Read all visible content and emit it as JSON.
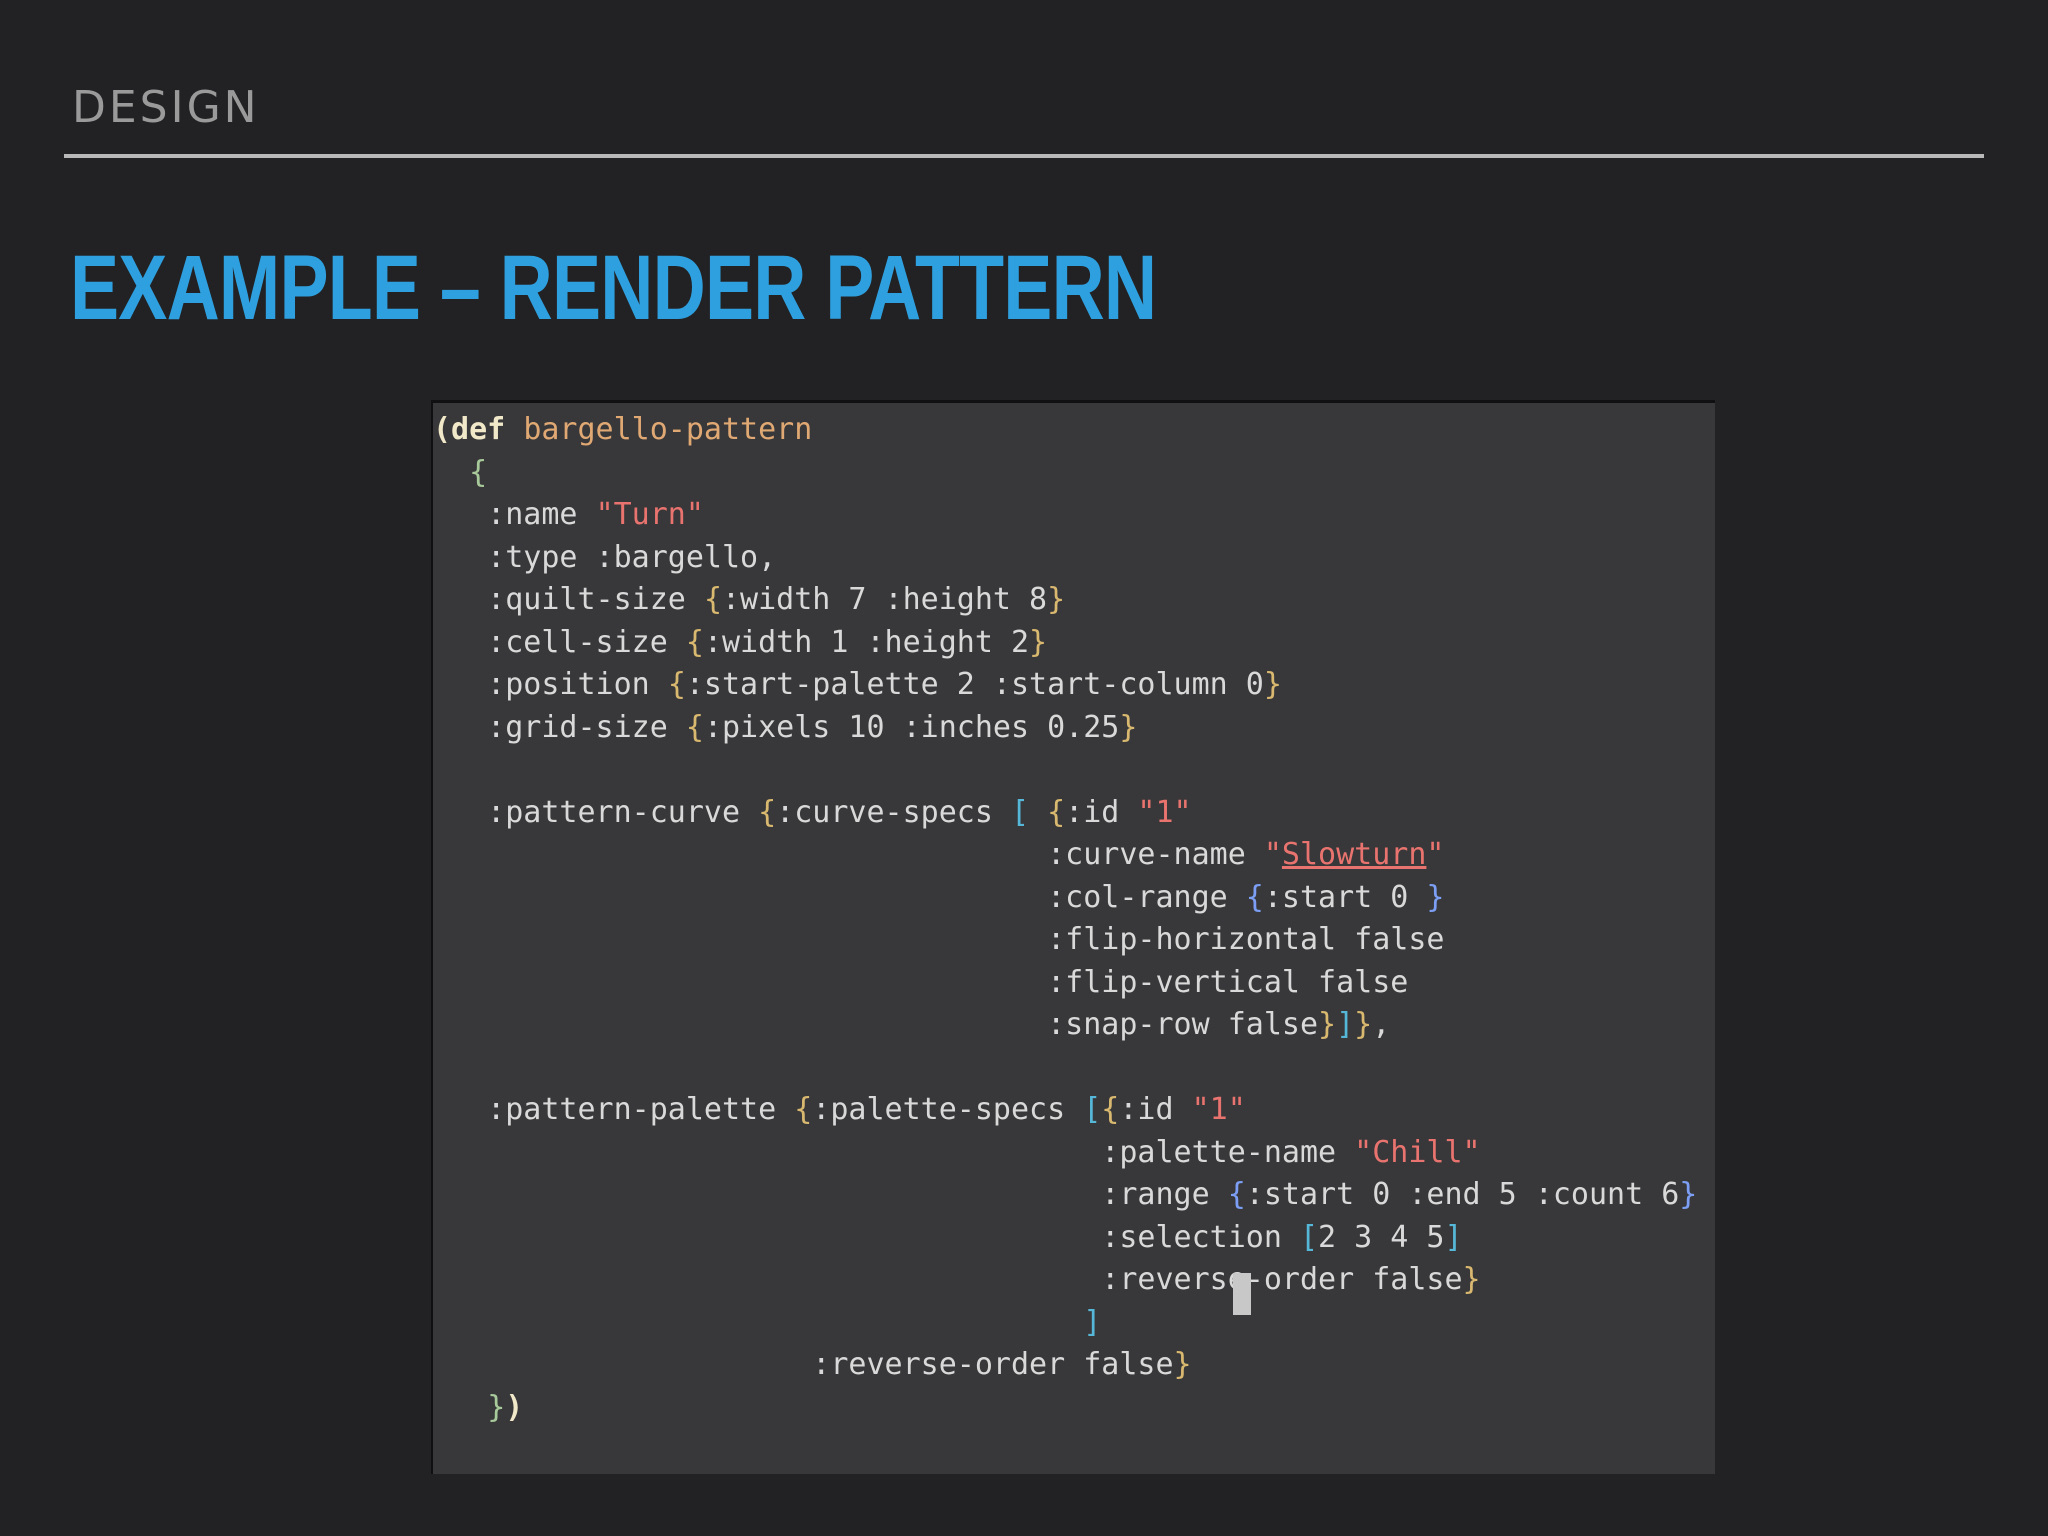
{
  "slide": {
    "section": "DESIGN",
    "title": "EXAMPLE – RENDER PATTERN"
  },
  "code": {
    "language": "clojure",
    "lines": [
      "(def bargello-pattern",
      "  {",
      "   :name \"Turn\"",
      "   :type :bargello,",
      "   :quilt-size {:width 7 :height 8}",
      "   :cell-size {:width 1 :height 2}",
      "   :position {:start-palette 2 :start-column 0}",
      "   :grid-size {:pixels 10 :inches 0.25}",
      "",
      "   :pattern-curve {:curve-specs [ {:id \"1\"",
      "                                  :curve-name \"Slowturn\"",
      "                                  :col-range {:start 0 }",
      "                                  :flip-horizontal false",
      "                                  :flip-vertical false",
      "                                  :snap-row false}]},",
      "",
      "   :pattern-palette {:palette-specs [{:id \"1\"",
      "                                     :palette-name \"Chill\"",
      "                                     :range {:start 0 :end 5 :count 6}",
      "                                     :selection [2 3 4 5]",
      "                                     :reverse-order false}",
      "                                    ]",
      "                     :reverse-order false}",
      "   })"
    ]
  }
}
